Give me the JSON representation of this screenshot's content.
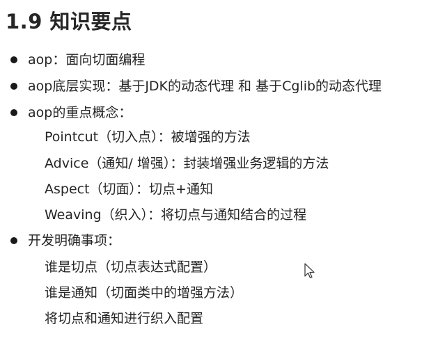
{
  "title": "1.9 知识要点",
  "bullets": [
    {
      "text": "aop：面向切面编程"
    },
    {
      "text": "aop底层实现：基于JDK的动态代理 和 基于Cglib的动态代理"
    },
    {
      "text": "aop的重点概念：",
      "subitems": [
        "Pointcut（切入点）：被增强的方法",
        "Advice（通知/ 增强）：封装增强业务逻辑的方法",
        "Aspect（切面）：切点+通知",
        "Weaving（织入）：将切点与通知结合的过程"
      ]
    },
    {
      "text": "开发明确事项：",
      "subitems": [
        "谁是切点（切点表达式配置）",
        "谁是通知（切面类中的增强方法）",
        "将切点和通知进行织入配置"
      ]
    }
  ],
  "icons": {
    "bullet": "bullet-dot-icon",
    "cursor": "mouse-pointer-icon"
  },
  "colors": {
    "text": "#262626",
    "bullet": "#1a1a1a",
    "background": "#ffffff"
  }
}
